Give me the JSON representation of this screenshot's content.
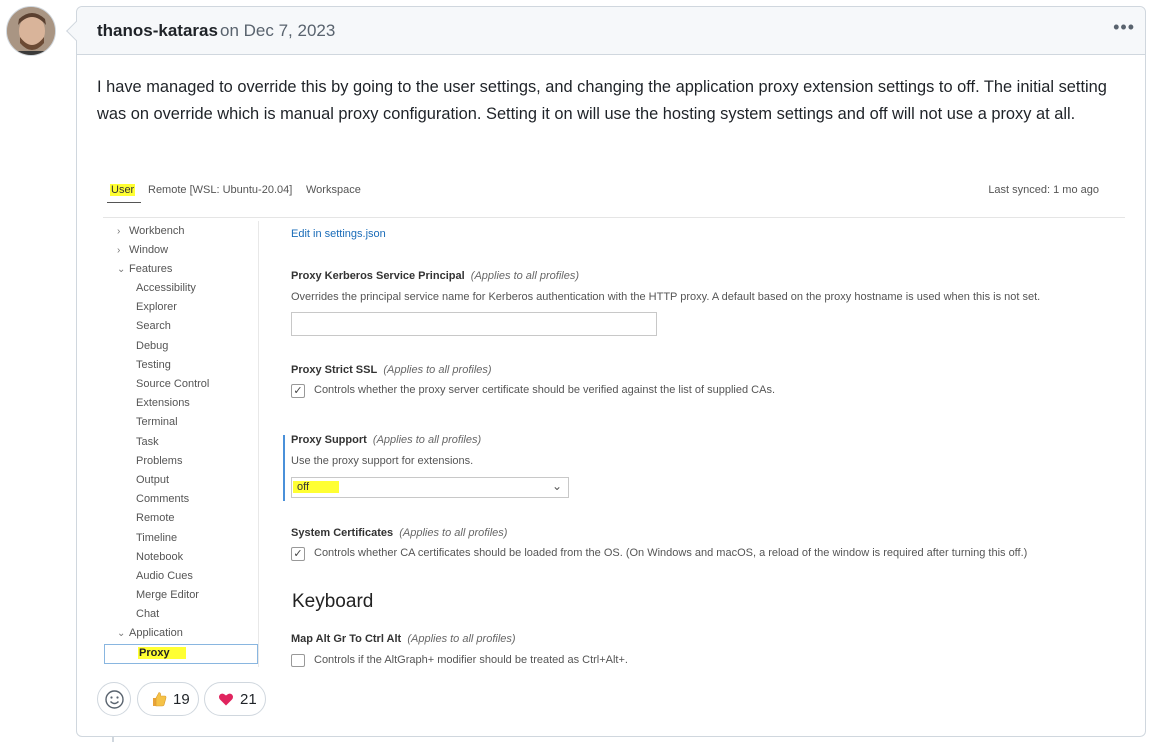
{
  "comment": {
    "author": "thanos-kataras",
    "date": "on Dec 7, 2023",
    "menu_label": "•••",
    "body": "I have managed to override this by going to the user settings, and changing the application proxy extension settings to off. The initial setting was on override which is manual proxy configuration. Setting it on will use the hosting system settings and off will not use a proxy at all."
  },
  "screenshot": {
    "tabs": {
      "user": "User",
      "remote": "Remote [WSL: Ubuntu-20.04]",
      "workspace": "Workspace",
      "last_synced": "Last synced: 1 mo ago"
    },
    "tree": {
      "workbench": "Workbench",
      "window": "Window",
      "features": "Features",
      "features_items": [
        "Accessibility",
        "Explorer",
        "Search",
        "Debug",
        "Testing",
        "Source Control",
        "Extensions",
        "Terminal",
        "Task",
        "Problems",
        "Output",
        "Comments",
        "Remote",
        "Timeline",
        "Notebook",
        "Audio Cues",
        "Merge Editor",
        "Chat"
      ],
      "application": "Application",
      "proxy": "Proxy"
    },
    "settings": {
      "edit_link": "Edit in settings.json",
      "kerberos_title": "Proxy Kerberos Service Principal",
      "kerberos_scope": "(Applies to all profiles)",
      "kerberos_desc": "Overrides the principal service name for Kerberos authentication with the HTTP proxy. A default based on the proxy hostname is used when this is not set.",
      "strict_title": "Proxy Strict SSL",
      "strict_scope": "(Applies to all profiles)",
      "strict_desc": "Controls whether the proxy server certificate should be verified against the list of supplied CAs.",
      "support_title": "Proxy Support",
      "support_scope": "(Applies to all profiles)",
      "support_desc": "Use the proxy support for extensions.",
      "support_value": "off",
      "certs_title": "System Certificates",
      "certs_scope": "(Applies to all profiles)",
      "certs_desc": "Controls whether CA certificates should be loaded from the OS. (On Windows and macOS, a reload of the window is required after turning this off.)",
      "keyboard_heading": "Keyboard",
      "altgr_title": "Map Alt Gr To Ctrl Alt",
      "altgr_scope": "(Applies to all profiles)",
      "altgr_desc": "Controls if the AltGraph+ modifier should be treated as Ctrl+Alt+."
    }
  },
  "reactions": {
    "thumbs_count": "19",
    "heart_count": "21"
  },
  "colors": {
    "highlight": "#ffff33",
    "link": "#1a6cb8",
    "heart": "#e0245e"
  }
}
